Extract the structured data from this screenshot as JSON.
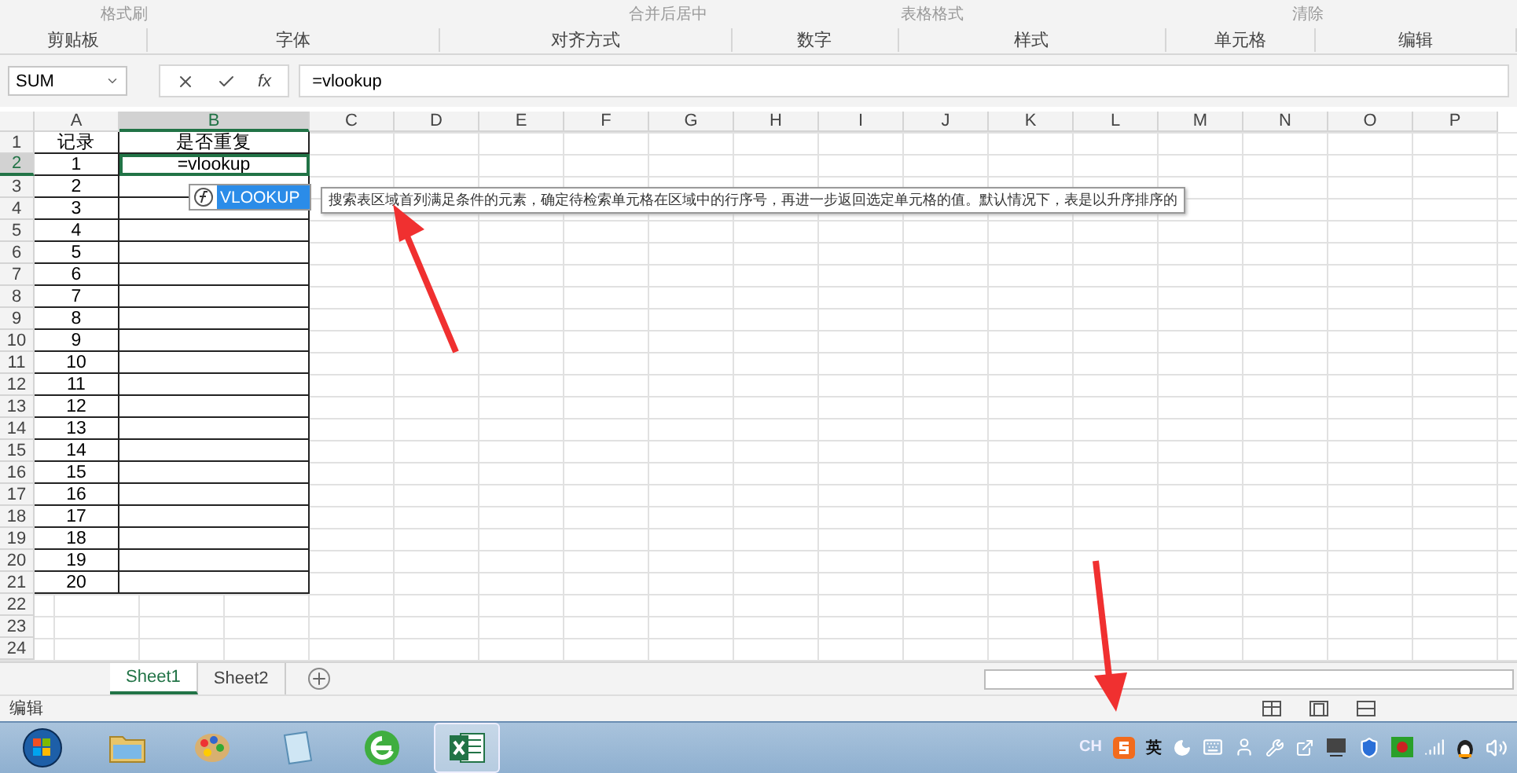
{
  "ribbon": {
    "partial_labels": [
      {
        "kind": "clipboard",
        "label": "格式刷"
      },
      {
        "kind": "merge",
        "label": "合并后居中"
      },
      {
        "kind": "styles",
        "label": "表格格式"
      },
      {
        "kind": "clear",
        "label": "清除"
      }
    ],
    "groups": [
      "剪贴板",
      "字体",
      "对齐方式",
      "数字",
      "样式",
      "单元格",
      "编辑"
    ]
  },
  "name_box": "SUM",
  "fx": "fx",
  "formula": "=vlookup",
  "columns": [
    {
      "label": "A",
      "selected": false
    },
    {
      "label": "B",
      "selected": true
    },
    {
      "label": "C",
      "selected": false
    },
    {
      "label": "D",
      "selected": false
    },
    {
      "label": "E",
      "selected": false
    },
    {
      "label": "F",
      "selected": false
    },
    {
      "label": "G",
      "selected": false
    },
    {
      "label": "H",
      "selected": false
    },
    {
      "label": "I",
      "selected": false
    },
    {
      "label": "J",
      "selected": false
    },
    {
      "label": "K",
      "selected": false
    },
    {
      "label": "L",
      "selected": false
    },
    {
      "label": "M",
      "selected": false
    },
    {
      "label": "N",
      "selected": false
    },
    {
      "label": "O",
      "selected": false
    },
    {
      "label": "P",
      "selected": false
    }
  ],
  "rows": [
    {
      "number": "1",
      "a": "记录",
      "b": "是否重复",
      "selected": false
    },
    {
      "number": "2",
      "a": "1",
      "b": "=vlookup",
      "selected": true
    },
    {
      "number": "3",
      "a": "2",
      "selected": false
    },
    {
      "number": "4",
      "a": "3",
      "selected": false
    },
    {
      "number": "5",
      "a": "4",
      "selected": false
    },
    {
      "number": "6",
      "a": "5",
      "selected": false
    },
    {
      "number": "7",
      "a": "6",
      "selected": false
    },
    {
      "number": "8",
      "a": "7",
      "selected": false
    },
    {
      "number": "9",
      "a": "8",
      "selected": false
    },
    {
      "number": "10",
      "a": "9",
      "selected": false
    },
    {
      "number": "11",
      "a": "10",
      "selected": false
    },
    {
      "number": "12",
      "a": "11",
      "selected": false
    },
    {
      "number": "13",
      "a": "12",
      "selected": false
    },
    {
      "number": "14",
      "a": "13",
      "selected": false
    },
    {
      "number": "15",
      "a": "14",
      "selected": false
    },
    {
      "number": "16",
      "a": "15",
      "selected": false
    },
    {
      "number": "17",
      "a": "16",
      "selected": false
    },
    {
      "number": "18",
      "a": "17",
      "selected": false
    },
    {
      "number": "19",
      "a": "18",
      "selected": false
    },
    {
      "number": "20",
      "a": "19",
      "selected": false
    },
    {
      "number": "21",
      "a": "20",
      "selected": false
    },
    {
      "number": "22",
      "selected": false
    },
    {
      "number": "23",
      "selected": false
    },
    {
      "number": "24",
      "selected": false
    }
  ],
  "autocomplete": [
    {
      "label": "VLOOKUP",
      "selected": true
    }
  ],
  "tooltip": "搜索表区域首列满足条件的元素，确定待检索单元格在区域中的行序号，再进一步返回选定单元格的值。默认情况下，表是以升序排序的",
  "sheets": [
    {
      "label": "Sheet1",
      "selected": true
    },
    {
      "label": "Sheet2",
      "selected": false
    }
  ],
  "status": "编辑",
  "taskbar": [
    {
      "kind": "start",
      "active": false
    },
    {
      "kind": "folder",
      "active": false
    },
    {
      "kind": "paint",
      "active": false
    },
    {
      "kind": "notepad",
      "active": false
    },
    {
      "kind": "browser",
      "active": false
    },
    {
      "kind": "excel",
      "active": true
    }
  ],
  "tray": {
    "language": "CH",
    "ime": "英"
  }
}
